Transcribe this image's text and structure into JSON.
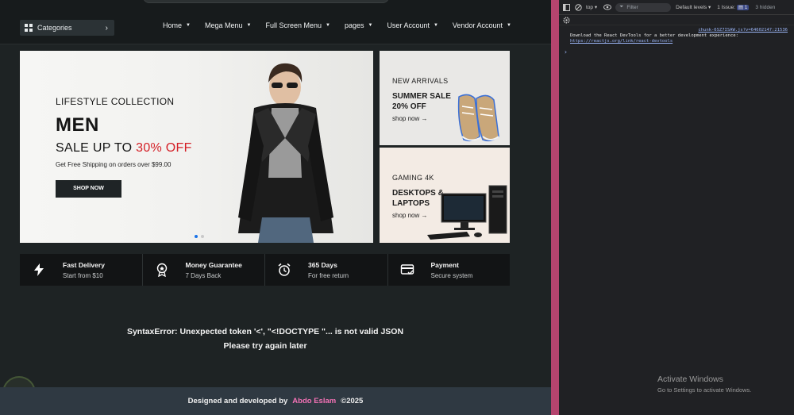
{
  "navbar": {
    "categories_label": "Categories",
    "menu": [
      {
        "label": "Home"
      },
      {
        "label": "Mega Menu"
      },
      {
        "label": "Full Screen Menu"
      },
      {
        "label": "pages"
      },
      {
        "label": "User Account"
      },
      {
        "label": "Vendor Account"
      }
    ]
  },
  "hero": {
    "kicker": "LIFESTYLE COLLECTION",
    "title": "MEN",
    "sale_prefix": "SALE UP TO ",
    "sale_highlight": "30% OFF",
    "shipping": "Get Free Shipping on orders over $99.00",
    "button": "SHOP NOW",
    "accent_color": "#d41f26",
    "active_dot_color": "#1a73e8"
  },
  "promos": [
    {
      "kicker": "NEW ARRIVALS",
      "title": "SUMMER SALE 20% OFF",
      "link": "shop now →"
    },
    {
      "kicker": "GAMING 4K",
      "title": "DESKTOPS & LAPTOPS",
      "link": "shop now →"
    }
  ],
  "features": [
    {
      "title": "Fast Delivery",
      "subtitle": "Start from $10",
      "icon": "bolt-icon"
    },
    {
      "title": "Money Guarantee",
      "subtitle": "7 Days Back",
      "icon": "medal-icon"
    },
    {
      "title": "365 Days",
      "subtitle": "For free return",
      "icon": "alarm-clock-icon"
    },
    {
      "title": "Payment",
      "subtitle": "Secure system",
      "icon": "card-icon"
    }
  ],
  "error": {
    "line1": "SyntaxError: Unexpected token '<', \"<!DOCTYPE \"... is not valid JSON",
    "line2": "Please try again later"
  },
  "footer": {
    "prefix": "Designed and developed by",
    "author": "Abdo Eslam",
    "year": "©2025",
    "author_color": "#f472b6"
  },
  "devtools": {
    "context": "top",
    "filter_placeholder": "Filter",
    "levels": "Default levels",
    "issues": "1 Issue:",
    "issues_count": "1",
    "hidden": "3 hidden",
    "source_link": "chunk-6SZ7ISAW.js?v=64602147:21536",
    "message": "Download the React DevTools for a better development experience:",
    "message_url": "https://reactjs.org/link/react-devtools",
    "prompt": "›"
  },
  "windows": {
    "activate_title": "Activate Windows",
    "activate_sub": "Go to Settings to activate Windows."
  }
}
